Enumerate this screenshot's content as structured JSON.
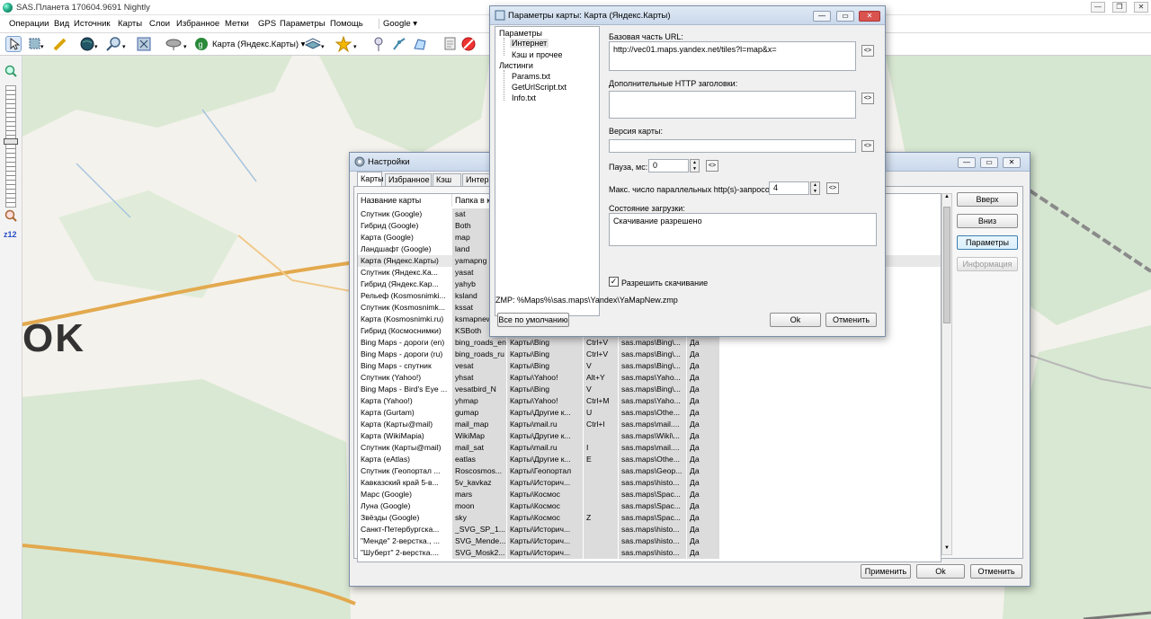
{
  "app": {
    "title": "SAS.Планета 170604.9691 Nightly"
  },
  "menu": [
    "Операции",
    "Вид",
    "Источник",
    "Карты",
    "Слои",
    "Избранное",
    "Метки",
    "GPS",
    "Параметры",
    "Помощь",
    "Google"
  ],
  "toolbar": {
    "map_selector": "Карта (Яндекс.Карты)"
  },
  "zoom": {
    "label": "z12",
    "level_fraction": 0.45
  },
  "map": {
    "label": "OK"
  },
  "settings": {
    "title": "Настройки",
    "tabs": [
      "Карты",
      "Избранное",
      "Кэш",
      "Интер"
    ],
    "columns": [
      "Название карты",
      "Папка в к"
    ],
    "rows": [
      [
        "Спутник (Google)",
        "sat",
        "",
        "",
        "",
        ""
      ],
      [
        "Гибрид (Google)",
        "Both",
        "",
        "",
        "",
        ""
      ],
      [
        "Карта (Google)",
        "map",
        "",
        "",
        "",
        ""
      ],
      [
        "Ландшафт (Google)",
        "land",
        "",
        "",
        "",
        ""
      ],
      [
        "Карта (Яндекс.Карты)",
        "yamapng",
        "",
        "",
        "",
        ""
      ],
      [
        "Спутник (Яндекс.Ка...",
        "yasat",
        "",
        "",
        "",
        ""
      ],
      [
        "Гибрид (Яндекс.Кар...",
        "yahyb",
        "",
        "",
        "",
        ""
      ],
      [
        "Рельеф (Kosmosnimki...",
        "ksland",
        "",
        "",
        "",
        ""
      ],
      [
        "Спутник (Kosmosnimk...",
        "kssat",
        "",
        "",
        "",
        ""
      ],
      [
        "Карта (Kosmosnimki.ru)",
        "ksmapnew",
        "",
        "",
        "",
        ""
      ],
      [
        "Гибрид (Космоснимки)",
        "KSBoth",
        "",
        "",
        "",
        ""
      ],
      [
        "Bing Maps - дороги (en)",
        "bing_roads_en",
        "Карты\\Bing",
        "Ctrl+V",
        "sas.maps\\Bing\\...",
        "Да"
      ],
      [
        "Bing Maps - дороги (ru)",
        "bing_roads_ru",
        "Карты\\Bing",
        "Ctrl+V",
        "sas.maps\\Bing\\...",
        "Да"
      ],
      [
        "Bing Maps - спутник",
        "vesat",
        "Карты\\Bing",
        "V",
        "sas.maps\\Bing\\...",
        "Да"
      ],
      [
        "Спутник (Yahoo!)",
        "yhsat",
        "Карты\\Yahoo!",
        "Alt+Y",
        "sas.maps\\Yaho...",
        "Да"
      ],
      [
        "Bing Maps - Bird's Eye ...",
        "vesatbird_N",
        "Карты\\Bing",
        "V",
        "sas.maps\\Bing\\...",
        "Да"
      ],
      [
        "Карта (Yahoo!)",
        "yhmap",
        "Карты\\Yahoo!",
        "Ctrl+M",
        "sas.maps\\Yaho...",
        "Да"
      ],
      [
        "Карта (Gurtam)",
        "gumap",
        "Карты\\Другие к...",
        "U",
        "sas.maps\\Othe...",
        "Да"
      ],
      [
        "Карта (Карты@mail)",
        "mail_map",
        "Карты\\mail.ru",
        "Ctrl+I",
        "sas.maps\\mail....",
        "Да"
      ],
      [
        "Карта (WikiMapia)",
        "WikiMap",
        "Карты\\Другие к...",
        "",
        "sas.maps\\Wiki\\...",
        "Да"
      ],
      [
        "Спутник (Карты@mail)",
        "mail_sat",
        "Карты\\mail.ru",
        "I",
        "sas.maps\\mail....",
        "Да"
      ],
      [
        "Карта (eAtlas)",
        "eatlas",
        "Карты\\Другие к...",
        "E",
        "sas.maps\\Othe...",
        "Да"
      ],
      [
        "Спутник (Геопортал ...",
        "Roscosmos...",
        "Карты\\Геопортал",
        "",
        "sas.maps\\Geop...",
        "Да"
      ],
      [
        "Кавказский край 5-в...",
        "5v_kavkaz",
        "Карты\\Историч...",
        "",
        "sas.maps\\histo...",
        "Да"
      ],
      [
        "Марс (Google)",
        "mars",
        "Карты\\Космос",
        "",
        "sas.maps\\Spac...",
        "Да"
      ],
      [
        "Луна (Google)",
        "moon",
        "Карты\\Космос",
        "",
        "sas.maps\\Spac...",
        "Да"
      ],
      [
        "Звёзды (Google)",
        "sky",
        "Карты\\Космос",
        "Z",
        "sas.maps\\Spac...",
        "Да"
      ],
      [
        "Санкт-Петербургска...",
        "_SVG_SP_1...",
        "Карты\\Историч...",
        "",
        "sas.maps\\histo...",
        "Да"
      ],
      [
        "\"Менде\" 2-верстка., ...",
        "SVG_Mende...",
        "Карты\\Историч...",
        "",
        "sas.maps\\histo...",
        "Да"
      ],
      [
        "\"Шуберт\" 2-верстка....",
        "SVG_Mosk2...",
        "Карты\\Историч...",
        "",
        "sas.maps\\histo...",
        "Да"
      ]
    ],
    "side_buttons": [
      "Вверх",
      "Вниз",
      "Параметры",
      "Информация"
    ],
    "bottom_buttons": [
      "Применить",
      "Ok",
      "Отменить"
    ]
  },
  "params": {
    "title": "Параметры карты: Карта (Яндекс.Карты)",
    "tree": {
      "params": "Параметры",
      "internet": "Интернет",
      "cache": "Кэш и прочее",
      "listings": "Листинги",
      "f1": "Params.txt",
      "f2": "GetUrlScript.txt",
      "f3": "Info.txt"
    },
    "url_label": "Базовая часть URL:",
    "url_value": "http://vec01.maps.yandex.net/tiles?l=map&x=",
    "headers_label": "Дополнительные HTTP заголовки:",
    "version_label": "Версия карты:",
    "pause_label": "Пауза, мс:",
    "pause_value": "0",
    "max_label": "Макс. число параллельных http(s)-запросов:",
    "max_value": "4",
    "state_label": "Состояние загрузки:",
    "state_value": "Скачивание разрешено",
    "allow_label": "Разрешить скачивание",
    "reset_btn": "<>",
    "zmp": "ZMP:  %Maps%\\sas.maps\\Yandex\\YaMapNew.zmp",
    "defaults_btn": "Все по умолчанию",
    "ok_btn": "Ok",
    "cancel_btn": "Отменить"
  }
}
